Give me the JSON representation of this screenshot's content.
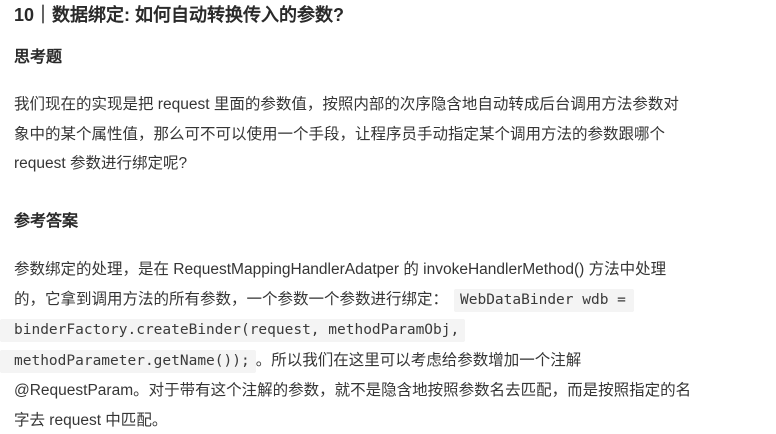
{
  "chapter": {
    "title": "10｜数据绑定: 如何自动转换传入的参数?"
  },
  "think": {
    "heading": "思考题",
    "lines": [
      "我们现在的实现是把 request 里面的参数值，按照内部的次序隐含地自动转成后台调用方法参数对",
      "象中的某个属性值，那么可不可以使用一个手段，让程序员手动指定某个调用方法的参数跟哪个",
      "request 参数进行绑定呢?"
    ]
  },
  "answer": {
    "heading": "参考答案",
    "line1": "参数绑定的处理，是在 RequestMappingHandlerAdatper 的 invokeHandlerMethod() 方法中处理",
    "line2_text": "的，它拿到调用方法的所有参数，一个参数一个参数进行绑定：",
    "code_part1": "WebDataBinder wdb =",
    "code_part2": "binderFactory.createBinder(request, methodParamObj,",
    "code_part3": "methodParameter.getName());",
    "line4_text": "。所以我们在这里可以考虑给参数增加一个注解",
    "line5": "@RequestParam。对于带有这个注解的参数，就不是隐含地按照参数名去匹配，而是按照指定的名",
    "line6": "字去 request 中匹配。"
  }
}
